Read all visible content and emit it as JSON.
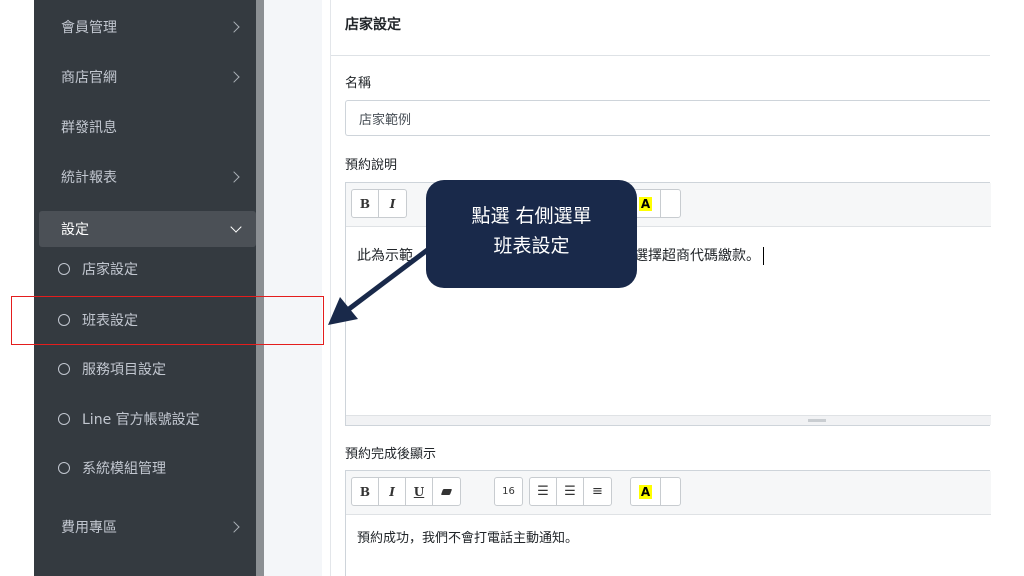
{
  "sidebar": {
    "items": [
      {
        "label": "會員管理"
      },
      {
        "label": "商店官網"
      },
      {
        "label": "群發訊息"
      },
      {
        "label": "統計報表"
      },
      {
        "label": "設定"
      },
      {
        "label": "費用專區"
      }
    ],
    "sub_items": [
      {
        "label": "店家設定"
      },
      {
        "label": "班表設定"
      },
      {
        "label": "服務項目設定"
      },
      {
        "label": "Line 官方帳號設定"
      },
      {
        "label": "系統模組管理"
      }
    ]
  },
  "panel": {
    "title": "店家設定",
    "name_label": "名稱",
    "name_value": "店家範例",
    "booking_desc_label": "預約說明",
    "booking_desc_visible_start": "此為示範",
    "booking_desc_visible_end": "選擇超商代碼繳款。",
    "booking_done_label": "預約完成後顯示",
    "booking_done_text": "預約成功，我們不會打電話主動通知。"
  },
  "toolbar": {
    "bold": "B",
    "italic": "I",
    "underline": "U",
    "font_size": "16",
    "highlight": "A"
  },
  "callout": {
    "line1": "點選 右側選單",
    "line2": "班表設定"
  },
  "colors": {
    "sidebar_bg": "#343a40",
    "callout_bg": "#19294a",
    "highlight_box": "#e41d1d",
    "highlight_yellow": "#ffff00"
  }
}
